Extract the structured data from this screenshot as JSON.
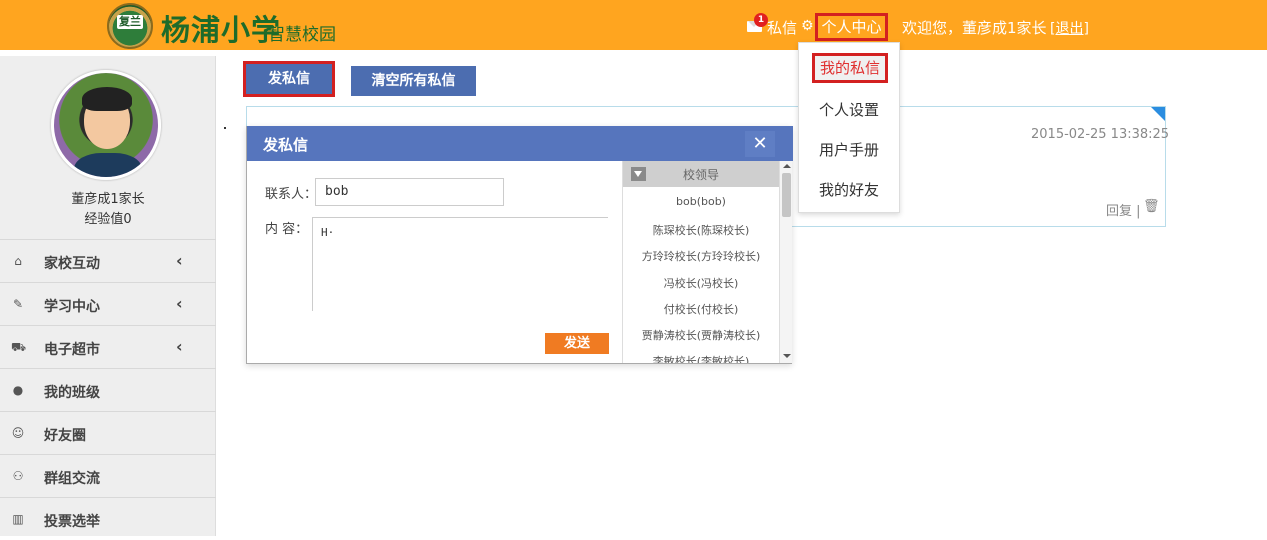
{
  "header": {
    "logo_badge": "复兰",
    "logo_title": "杨浦小学",
    "logo_subtitle": "智慧校园",
    "message_badge_count": "1",
    "message_label": "私信",
    "personal_center_label": "个人中心",
    "welcome_text": "欢迎您，董彦成1家长",
    "logout_label": "[退出]",
    "colors": {
      "bar": "#FFA51F",
      "highlight_border": "#d32020"
    }
  },
  "dropdown": {
    "items": [
      "我的私信",
      "个人设置",
      "用户手册",
      "我的好友"
    ],
    "active_index": 0
  },
  "sidebar": {
    "user_name": "董彦成1家长",
    "experience": "经验值0",
    "items": [
      {
        "label": "家校互动",
        "icon": "home-icon",
        "has_chevron": true
      },
      {
        "label": "学习中心",
        "icon": "edit-icon",
        "has_chevron": true
      },
      {
        "label": "电子超市",
        "icon": "cart-icon",
        "has_chevron": true
      },
      {
        "label": "我的班级",
        "icon": "user-icon",
        "has_chevron": false
      },
      {
        "label": "好友圈",
        "icon": "smile-icon",
        "has_chevron": false
      },
      {
        "label": "群组交流",
        "icon": "group-icon",
        "has_chevron": false
      },
      {
        "label": "投票选举",
        "icon": "bar-chart-icon",
        "has_chevron": false
      }
    ]
  },
  "toolbar": {
    "send_message_label": "发私信",
    "clear_all_label": "清空所有私信"
  },
  "message_card": {
    "timestamp": "2015-02-25 13:38:25",
    "reply_label": "回复 |"
  },
  "dialog": {
    "title": "发私信",
    "close_symbol": "✕",
    "contact_label": "联系人：",
    "contact_value": "bob",
    "content_label": "内 容：",
    "content_value": "H·",
    "send_label": "发送",
    "list": {
      "header": "校领导",
      "items": [
        "bob(bob)",
        "陈琛校长(陈琛校长)",
        "方玲玲校长(方玲玲校长)",
        "冯校长(冯校长)",
        "付校长(付校长)",
        "贾静涛校长(贾静涛校长)",
        "李敏校长(李敏校长)"
      ]
    }
  }
}
